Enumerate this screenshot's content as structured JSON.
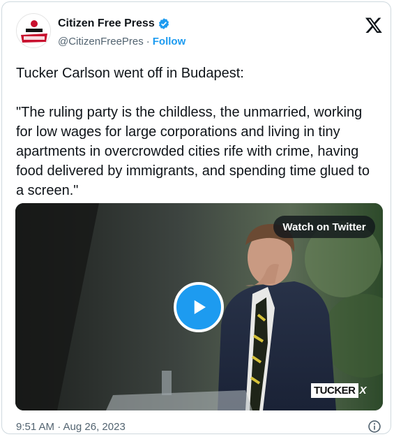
{
  "tweet": {
    "author_name": "Citizen Free Press",
    "handle": "@CitizenFreePres",
    "separator": "·",
    "follow_label": "Follow",
    "text": "Tucker Carlson went off in Budapest:\n\n\"The ruling party is the childless, the unmarried, working for low wages for large corporations and living in tiny apartments in overcrowded cities rife with crime, having food delivered by immigrants, and spending time glued to a screen.\"",
    "timestamp": "9:51 AM · Aug 26, 2023"
  },
  "media": {
    "watch_label": "Watch on Twitter",
    "watermark_left": "TUCKER",
    "watermark_right": "X"
  },
  "icons": {
    "verified": "verified-badge-icon",
    "platform": "x-logo-icon",
    "play": "play-icon",
    "info": "info-icon"
  },
  "colors": {
    "accent": "#1d9bf0",
    "text": "#0f1419",
    "muted": "#536471",
    "border": "#cfd9de"
  }
}
